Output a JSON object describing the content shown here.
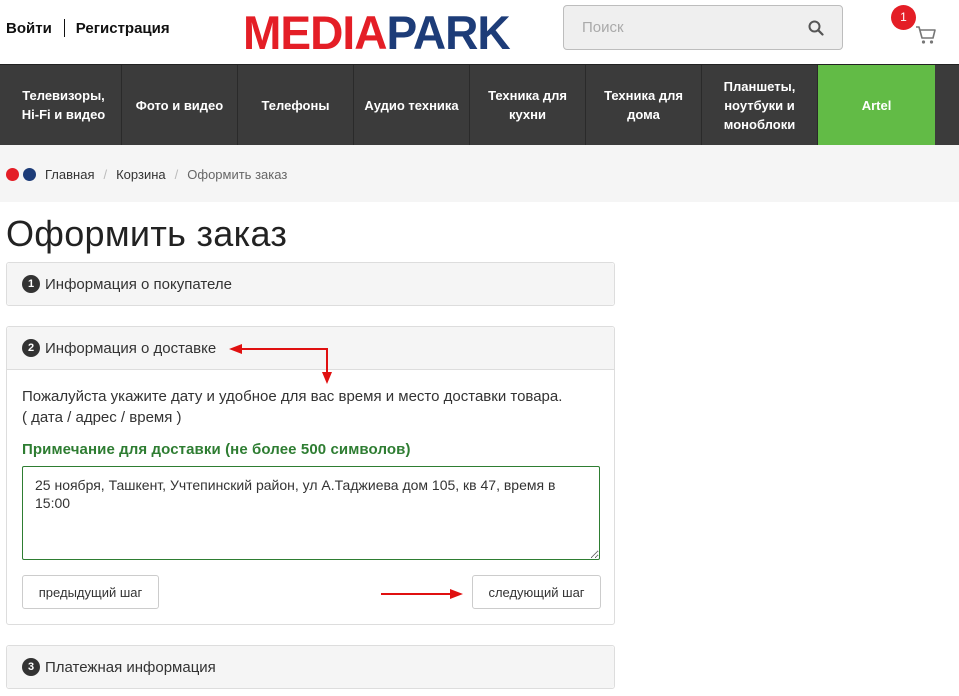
{
  "header": {
    "login_label": "Войти",
    "register_label": "Регистрация",
    "logo_part1": "MEDIA",
    "logo_part2": "PARK",
    "search_placeholder": "Поиск",
    "cart_count": "1"
  },
  "nav": {
    "items": [
      {
        "label": "Телевизоры, Hi-Fi и видео"
      },
      {
        "label": "Фото и видео"
      },
      {
        "label": "Телефоны"
      },
      {
        "label": "Аудио техника"
      },
      {
        "label": "Техника для кухни"
      },
      {
        "label": "Техника для дома"
      },
      {
        "label": "Планшеты, ноутбуки и моноблоки"
      },
      {
        "label": "Artel"
      }
    ]
  },
  "breadcrumb": {
    "items": [
      "Главная",
      "Корзина",
      "Оформить заказ"
    ]
  },
  "page_title": "Оформить заказ",
  "steps": [
    {
      "number": "1",
      "title": "Информация о покупателе"
    },
    {
      "number": "2",
      "title": "Информация о доставке"
    },
    {
      "number": "3",
      "title": "Платежная информация"
    }
  ],
  "delivery": {
    "description_line1": "Пожалуйста укажите дату и удобное для вас время и место доставки товара.",
    "description_line2": "( дата / адрес / время )",
    "note_label": "Примечание для доставки (не более 500 символов)",
    "note_value": "25 ноября, Ташкент, Учтепинский район, ул А.Таджиева дом 105, кв 47, время в 15:00",
    "prev_button": "предыдущий шаг",
    "next_button": "следующий шаг"
  },
  "colors": {
    "brand_red": "#e41e26",
    "brand_blue": "#1d3c78",
    "nav_bg": "#3b3b3b",
    "artel_green": "#62bb46",
    "annotation_arrow": "#e01010"
  }
}
